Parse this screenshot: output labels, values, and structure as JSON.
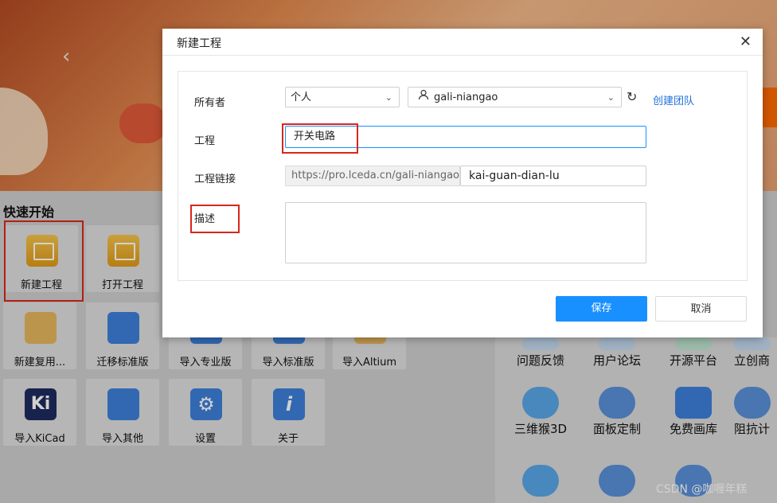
{
  "dialog": {
    "title": "新建工程",
    "close_label": "✕",
    "owner_label": "所有者",
    "owner_type": "个人",
    "owner_user": "gali-niangao",
    "refresh_icon": "↻",
    "create_team": "创建团队",
    "project_label": "工程",
    "project_value": "开关电路",
    "link_label": "工程链接",
    "link_prefix": "https://pro.lceda.cn/gali-niangao/",
    "link_value": "kai-guan-dian-lu",
    "desc_label": "描述",
    "desc_value": "",
    "save_label": "保存",
    "cancel_label": "取消"
  },
  "quick_start": {
    "title": "快速开始",
    "tiles": [
      {
        "label": "新建工程",
        "icon": "folder-icon"
      },
      {
        "label": "打开工程",
        "icon": "folder-icon"
      },
      {
        "label": "新建复用...",
        "icon": "chip-icon"
      },
      {
        "label": "迁移标准版",
        "icon": "std-pro-icon"
      },
      {
        "label": "导入专业版",
        "icon": "import-icon"
      },
      {
        "label": "导入标准版",
        "icon": "import-icon"
      },
      {
        "label": "导入Altium",
        "icon": "import-icon"
      },
      {
        "label": "导入KiCad",
        "icon": "kicad-icon",
        "glyph": "Ki"
      },
      {
        "label": "导入其他",
        "icon": "more-icon"
      },
      {
        "label": "设置",
        "icon": "gear-icon",
        "glyph": "⚙"
      },
      {
        "label": "关于",
        "icon": "info-icon",
        "glyph": "i"
      }
    ]
  },
  "right_panel": {
    "items": [
      {
        "label": "问题反馈"
      },
      {
        "label": "用户论坛"
      },
      {
        "label": "开源平台"
      },
      {
        "label": "立创商"
      },
      {
        "label": "三维猴3D"
      },
      {
        "label": "面板定制"
      },
      {
        "label": "免费画库"
      },
      {
        "label": "阻抗计"
      }
    ]
  },
  "watermark": "CSDN @咖喱年糕",
  "colors": {
    "primary": "#1890ff",
    "highlight": "#d9261c"
  }
}
